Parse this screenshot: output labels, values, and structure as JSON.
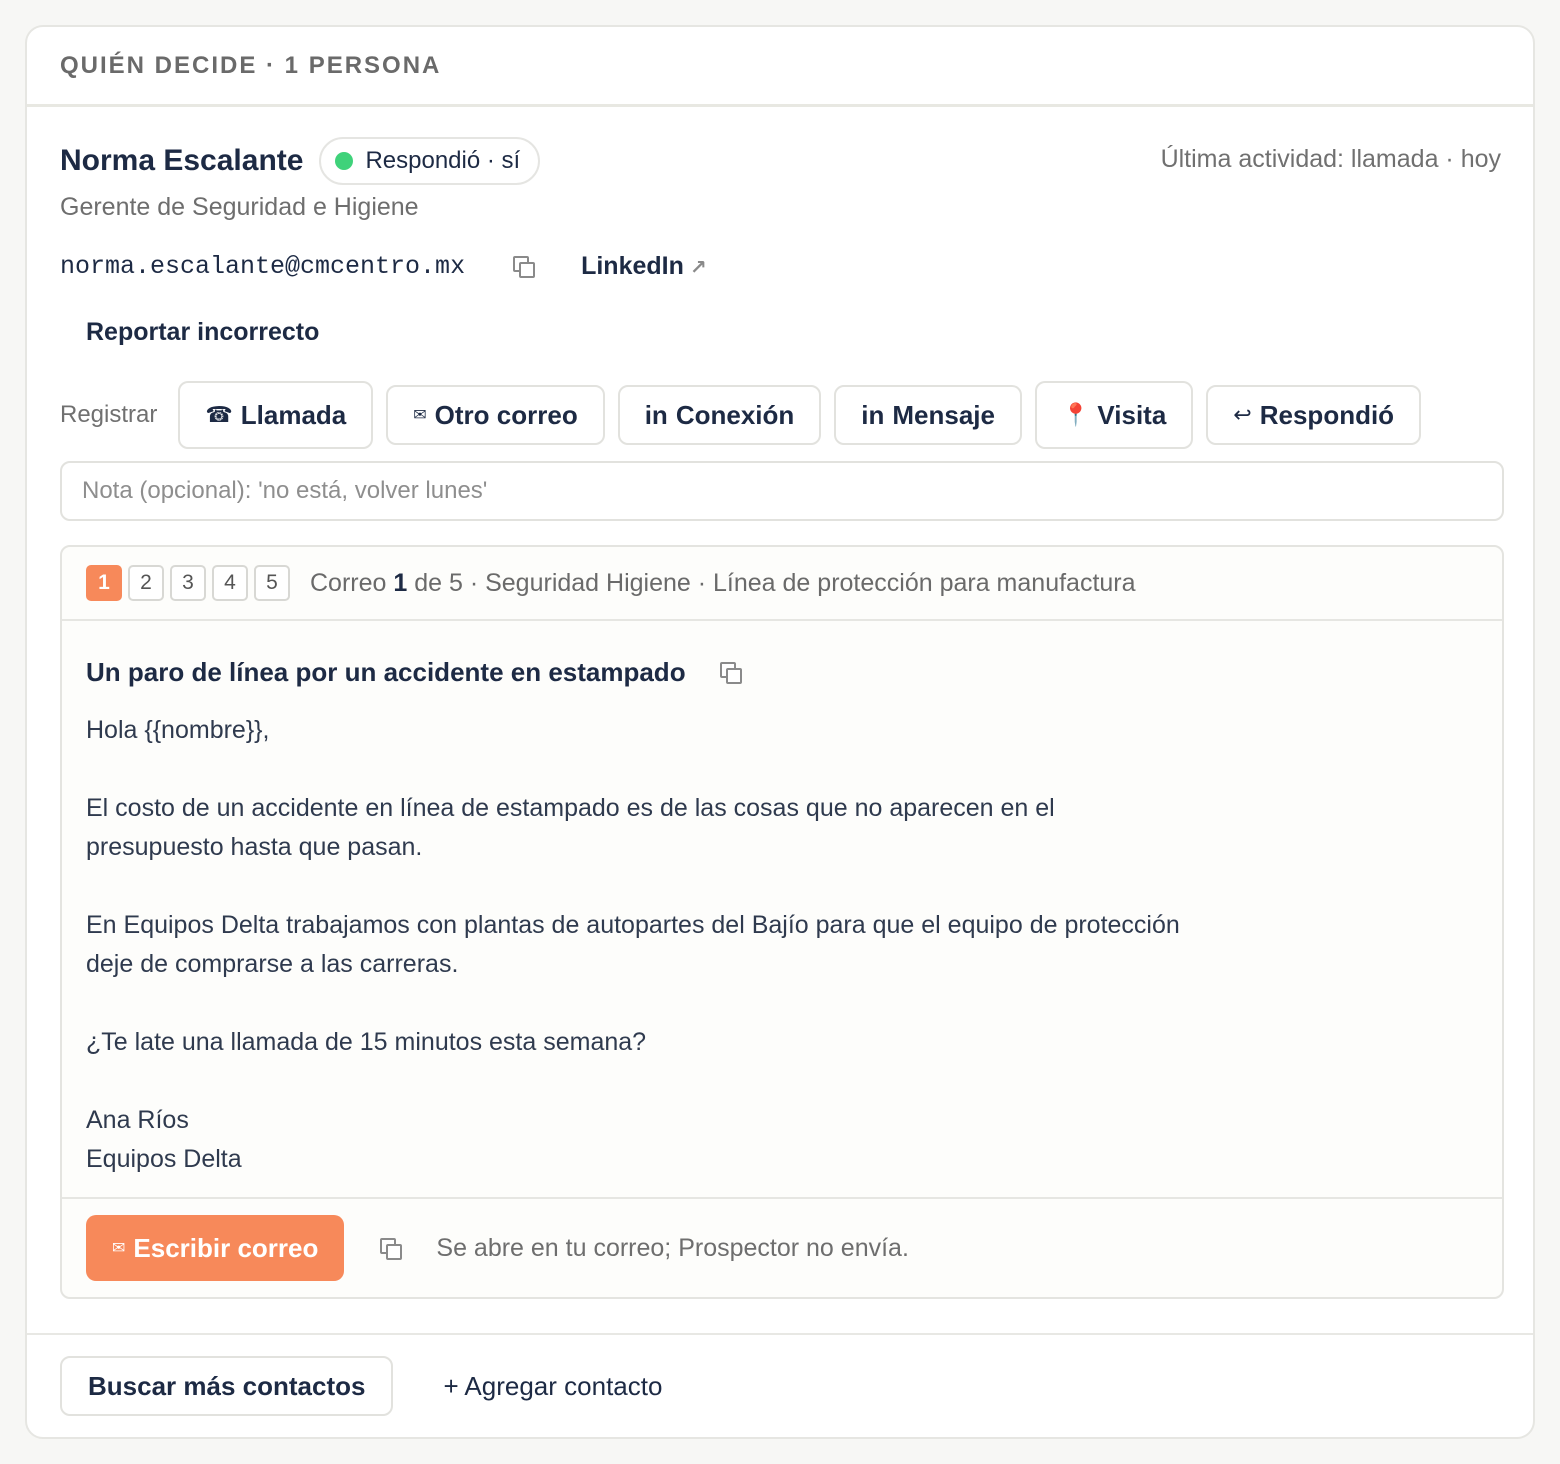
{
  "section": {
    "title": "QUIÉN DECIDE · 1 PERSONA"
  },
  "contact": {
    "name": "Norma Escalante",
    "status": {
      "label": "Respondió · sí",
      "color": "#3fd27a"
    },
    "last_activity": "Última actividad: llamada · hoy",
    "role": "Gerente de Seguridad e Higiene",
    "email": "norma.escalante@cmcentro.mx",
    "linkedin_label": "LinkedIn",
    "linkedin_arrow": "↗",
    "report_label": "Reportar incorrecto"
  },
  "register": {
    "label": "Registrar",
    "buttons": [
      {
        "icon": "☎",
        "label": "Llamada"
      },
      {
        "icon": "✉",
        "label": "Otro correo"
      },
      {
        "icon": "in",
        "label": "Conexión"
      },
      {
        "icon": "in",
        "label": "Mensaje"
      },
      {
        "icon": "📍",
        "label": "Visita"
      },
      {
        "icon": "↩",
        "label": "Respondió"
      }
    ],
    "note_placeholder": "Nota (opcional): 'no está, volver lunes'"
  },
  "email": {
    "steps": [
      "1",
      "2",
      "3",
      "4",
      "5"
    ],
    "active_step": 1,
    "sequence_prefix": "Correo",
    "sequence_current": "1",
    "sequence_suffix": "de 5 · Seguridad Higiene · Línea de protección para manufactura",
    "subject": "Un paro de línea por un accidente en estampado",
    "body": "Hola {{nombre}},\n\nEl costo de un accidente en línea de estampado es de las cosas que no aparecen en el presupuesto hasta que pasan.\n\nEn Equipos Delta trabajamos con plantas de autopartes del Bajío para que el equipo de protección deje de comprarse a las carreras.\n\n¿Te late una llamada de 15 minutos esta semana?\n\nAna Ríos\nEquipos Delta",
    "write_icon": "✉",
    "write_label": "Escribir correo",
    "footer_note": "Se abre en tu correo; Prospector no envía."
  },
  "footer": {
    "find_more_label": "Buscar más contactos",
    "add_contact_label": "+ Agregar contacto"
  },
  "colors": {
    "accent": "#f7895a",
    "text": "#1d2a44",
    "success": "#3fd27a"
  }
}
